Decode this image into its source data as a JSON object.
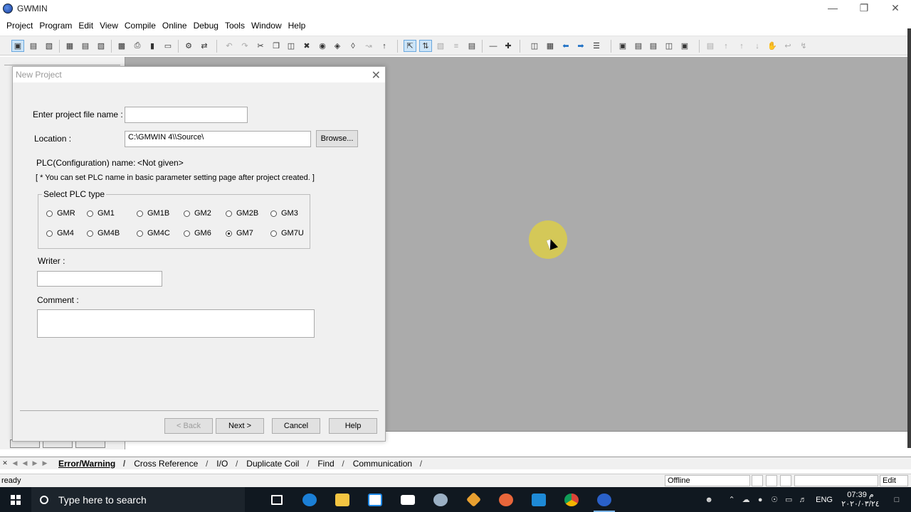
{
  "window": {
    "title": "GWMIN"
  },
  "menu": [
    "Project",
    "Program",
    "Edit",
    "View",
    "Compile",
    "Online",
    "Debug",
    "Tools",
    "Window",
    "Help"
  ],
  "dialog": {
    "title": "New Project",
    "project_name_label": "Enter project file name :",
    "project_name_value": "",
    "location_label": "Location :",
    "location_value": "C:\\GMWIN 4\\\\Source\\",
    "browse_label": "Browse...",
    "plc_name_label": "PLC(Configuration) name:",
    "plc_name_value": "<Not given>",
    "note": "[ * You can set PLC name in basic parameter setting page after project created. ]",
    "plc_type_title": "Select PLC type",
    "plc_types_row1": [
      "GMR",
      "GM1",
      "GM1B",
      "GM2",
      "GM2B",
      "GM3"
    ],
    "plc_types_row2": [
      "GM4",
      "GM4B",
      "GM4C",
      "GM6",
      "GM7",
      "GM7U"
    ],
    "selected_plc_type": "GM7",
    "writer_label": "Writer :",
    "writer_value": "",
    "comment_label": "Comment :",
    "comment_value": "",
    "buttons": {
      "back": "< Back",
      "next": "Next >",
      "cancel": "Cancel",
      "help": "Help"
    }
  },
  "output_tabs": [
    "Error/Warning",
    "Cross Reference",
    "I/O",
    "Duplicate Coil",
    "Find",
    "Communication"
  ],
  "active_output_tab": "Error/Warning",
  "status": {
    "text": "ready",
    "mode": "Offline",
    "edit": "Edit"
  },
  "taskbar": {
    "search_placeholder": "Type here to search",
    "lang": "ENG",
    "time": "07:39 م",
    "date": "۲۰۲۰/۰۳/۲٤"
  }
}
